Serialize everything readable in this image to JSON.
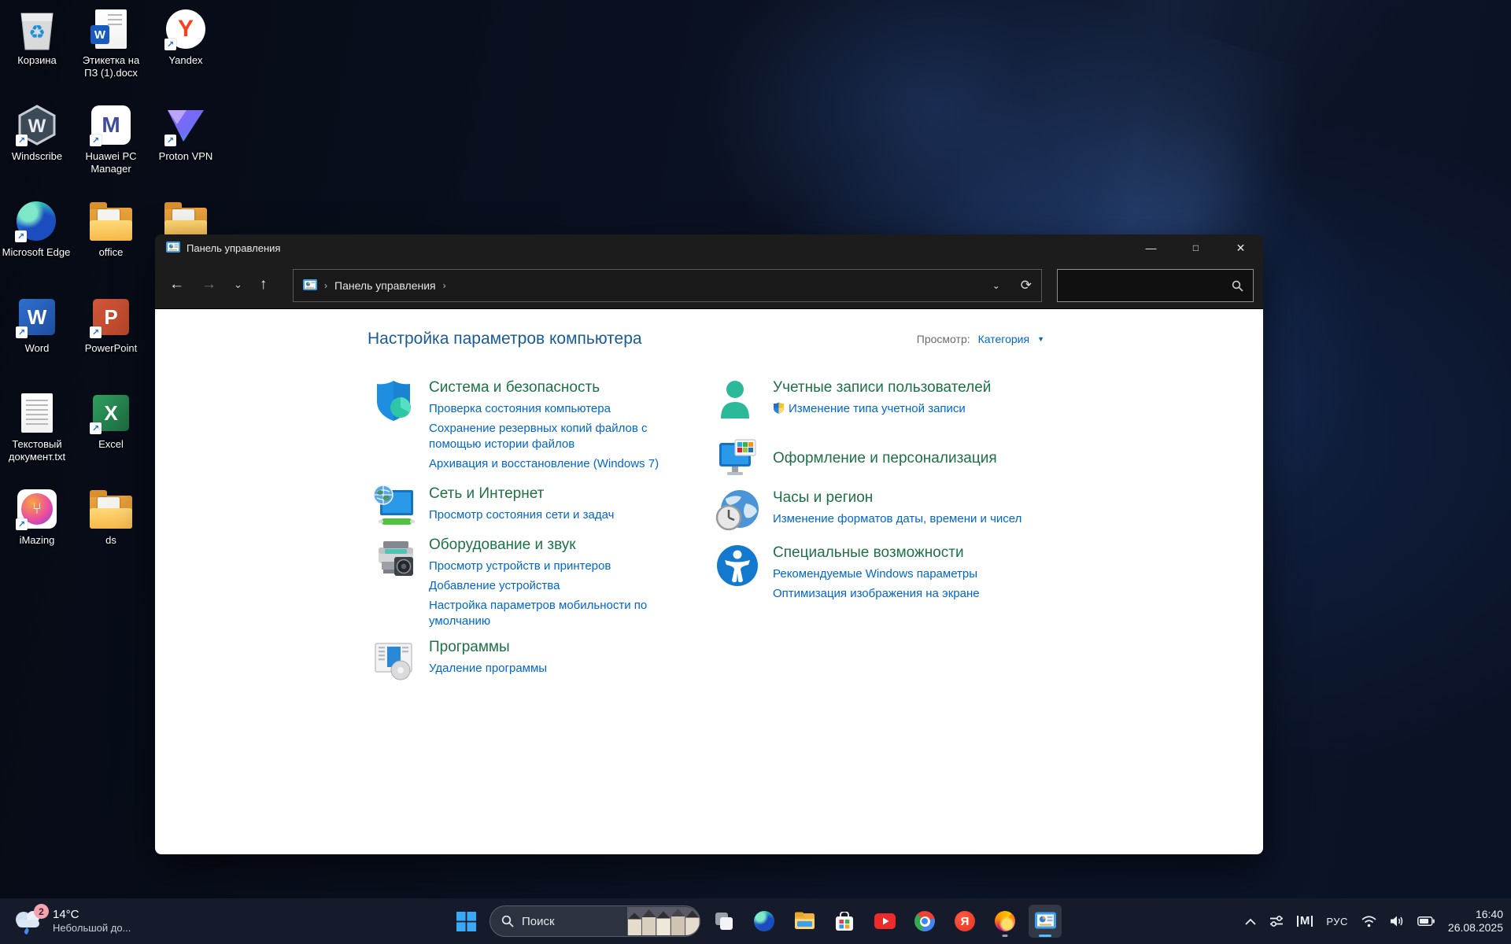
{
  "desktop": {
    "icons": [
      {
        "id": "recycle-bin",
        "label": "Корзина"
      },
      {
        "id": "docx-file",
        "label": "Этикетка на ПЗ (1).docx"
      },
      {
        "id": "yandex",
        "label": "Yandex"
      },
      {
        "id": "windscribe",
        "label": "Windscribe"
      },
      {
        "id": "huawei-pc-manager",
        "label": "Huawei PC Manager"
      },
      {
        "id": "proton-vpn",
        "label": "Proton VPN"
      },
      {
        "id": "microsoft-edge",
        "label": "Microsoft Edge"
      },
      {
        "id": "office-folder",
        "label": "office"
      },
      {
        "id": "word",
        "label": "Word"
      },
      {
        "id": "powerpoint",
        "label": "PowerPoint"
      },
      {
        "id": "txt-file",
        "label": "Текстовый документ.txt"
      },
      {
        "id": "excel",
        "label": "Excel"
      },
      {
        "id": "imazing",
        "label": "iMazing"
      },
      {
        "id": "ds-folder",
        "label": "ds"
      }
    ]
  },
  "window": {
    "title": "Панель управления",
    "breadcrumb_root": "Панель управления",
    "heading": "Настройка параметров компьютера",
    "view_label": "Просмотр:",
    "view_value": "Категория",
    "left_sections": [
      {
        "title": "Система и безопасность",
        "links": [
          "Проверка состояния компьютера",
          "Сохранение резервных копий файлов с помощью истории файлов",
          "Архивация и восстановление (Windows 7)"
        ]
      },
      {
        "title": "Сеть и Интернет",
        "links": [
          "Просмотр состояния сети и задач"
        ]
      },
      {
        "title": "Оборудование и звук",
        "links": [
          "Просмотр устройств и принтеров",
          "Добавление устройства",
          "Настройка параметров мобильности по умолчанию"
        ]
      },
      {
        "title": "Программы",
        "links": [
          "Удаление программы"
        ]
      }
    ],
    "right_sections": [
      {
        "title": "Учетные записи пользователей",
        "links": [
          "Изменение типа учетной записи"
        ]
      },
      {
        "title": "Оформление и персонализация",
        "links": []
      },
      {
        "title": "Часы и регион",
        "links": [
          "Изменение форматов даты, времени и чисел"
        ]
      },
      {
        "title": "Специальные возможности",
        "links": [
          "Рекомендуемые Windows параметры",
          "Оптимизация изображения на экране"
        ]
      }
    ]
  },
  "taskbar": {
    "weather": {
      "badge": "2",
      "temp": "14°C",
      "condition": "Небольшой до..."
    },
    "search_label": "Поиск",
    "tray": {
      "lang": "РУС",
      "time": "16:40",
      "date": "26.08.2025"
    }
  },
  "colors": {
    "category_green": "#1e7145",
    "link_blue": "#0066cc",
    "heading_blue": "#1a5a96",
    "taskbar_bg": "#161c2c"
  }
}
